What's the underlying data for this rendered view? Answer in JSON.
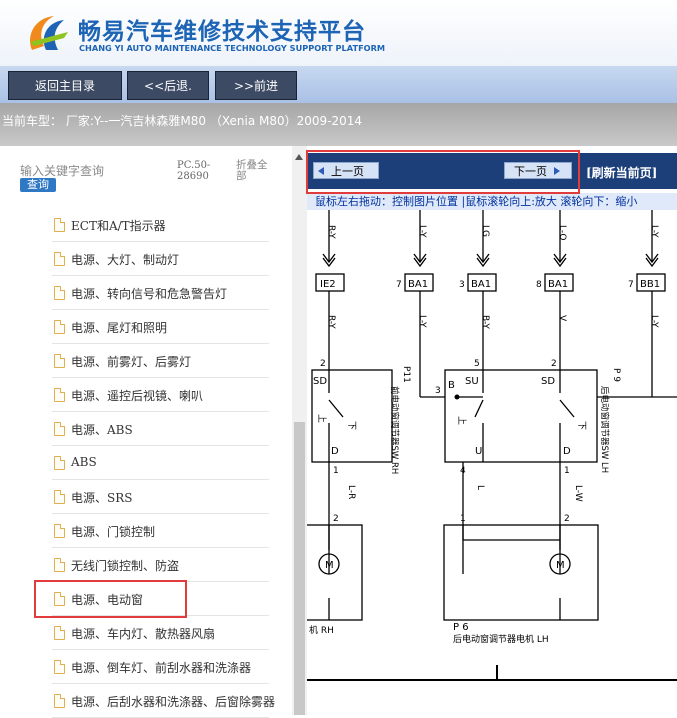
{
  "header": {
    "title_cn": "畅易汽车维修技术支持平台",
    "title_en": "CHANG YI AUTO MAINTENANCE TECHNOLOGY SUPPORT PLATFORM",
    "brand_color": "#1d64b5"
  },
  "nav": {
    "home": "返回主目录",
    "back": "<<后退.",
    "forward": ">>前进"
  },
  "model_line": "当前车型： 厂家:Y--一汽吉林森雅M80 （Xenia M80）2009-2014",
  "sidebar": {
    "search_placeholder": "输入关键字查询",
    "search_button": "查询",
    "code": "PC.50-28690",
    "collapse_all": "折叠全部",
    "selected_index": 11,
    "items": [
      {
        "label": "ECT和A/T指示器"
      },
      {
        "label": "电源、大灯、制动灯"
      },
      {
        "label": "电源、转向信号和危急警告灯"
      },
      {
        "label": "电源、尾灯和照明"
      },
      {
        "label": "电源、前雾灯、后雾灯"
      },
      {
        "label": "电源、遥控后视镜、喇叭"
      },
      {
        "label": "电源、ABS"
      },
      {
        "label": "ABS"
      },
      {
        "label": "电源、SRS"
      },
      {
        "label": "电源、门锁控制"
      },
      {
        "label": "无线门锁控制、防盗"
      },
      {
        "label": "电源、电动窗"
      },
      {
        "label": "电源、车内灯、散热器风扇"
      },
      {
        "label": "电源、倒车灯、前刮水器和洗涤器"
      },
      {
        "label": "电源、后刮水器和洗涤器、后窗除雾器"
      }
    ]
  },
  "viewer": {
    "prev_page": "上一页",
    "next_page": "下一页",
    "refresh": "[刷新当前页]",
    "hint": "鼠标左右拖动：控制图片位置 |鼠标滚轮向上:放大  滚轮向下：缩小",
    "highlight_color": "#e23b3b"
  },
  "diagram": {
    "wire_labels": [
      "R-Y",
      "L-Y",
      "LG",
      "L-O",
      "L-Y",
      "R-Y",
      "L-Y",
      "B-Y",
      "V",
      "L-Y",
      "L-R",
      "L",
      "L-W"
    ],
    "connectors": [
      "IE2",
      "BA1",
      "BA1",
      "BA1",
      "BB1"
    ],
    "pins": [
      "7",
      "3",
      "8",
      "7",
      "2",
      "5",
      "2",
      "3",
      "1",
      "4",
      "1",
      "2",
      "1",
      "2"
    ],
    "switch_terminals": [
      "SD",
      "D",
      "B",
      "SU",
      "SD",
      "U",
      "D"
    ],
    "switch_positions": [
      "上",
      "下",
      "上",
      "下"
    ],
    "p11_code": "P11",
    "p11_desc": "前电动窗调节器SW RH",
    "p9_code": "P 9",
    "p9_desc": "后电动窗调节器SW LH",
    "motor_symbol": "M",
    "rh_motor_label": "机 RH",
    "p6_code": "P 6",
    "lh_motor_label": "后电动窗调节器电机 LH"
  }
}
